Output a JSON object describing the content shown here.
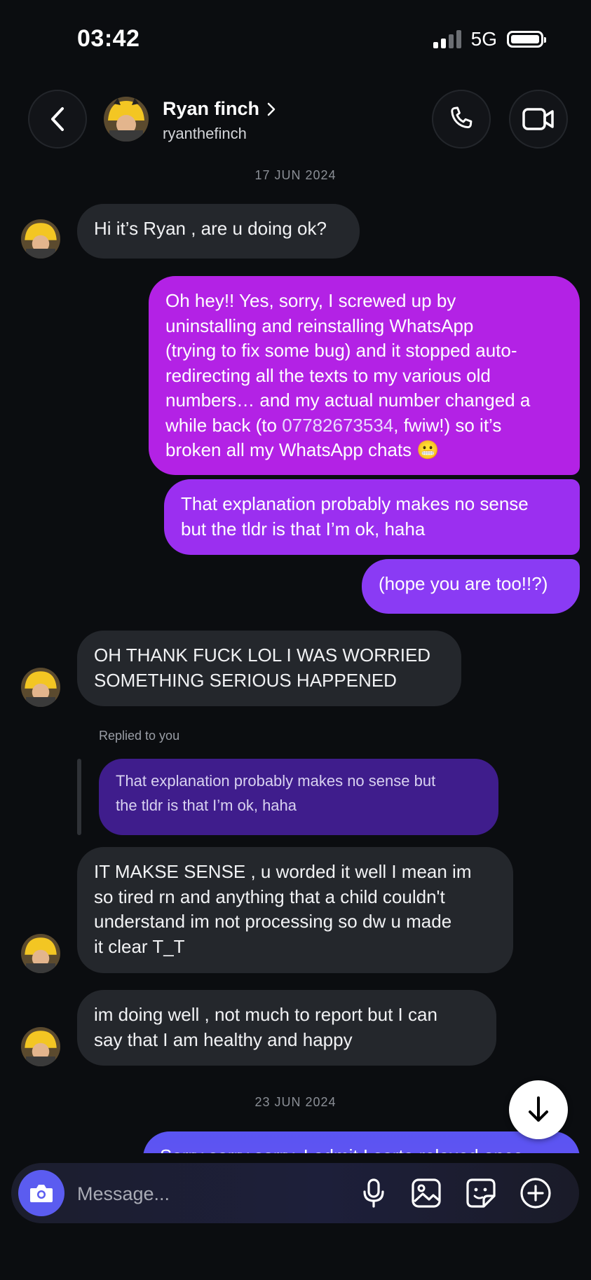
{
  "status_bar": {
    "time": "03:42",
    "network": "5G"
  },
  "header": {
    "name": "Ryan finch",
    "username": "ryanthefinch"
  },
  "dates": {
    "first": "17 JUN 2024",
    "second": "23 JUN 2024"
  },
  "messages": {
    "m1": "Hi it’s Ryan , are u doing ok?",
    "m2_lines": [
      "Oh hey!! Yes, sorry, I screwed up by",
      "uninstalling and reinstalling WhatsApp",
      "(trying to fix some bug) and it stopped auto-",
      "redirecting all the texts to my various old",
      "numbers… and my actual number changed a"
    ],
    "m2_l6_pre": "while back (to ",
    "m2_phone": "07782673534",
    "m2_l6_post": ", fwiw!) so it’s",
    "m2_l7": "broken all my WhatsApp chats 😬",
    "m3_lines": [
      "That explanation probably makes no sense",
      "but the tldr is that I’m ok, haha"
    ],
    "m4": "(hope you are too!!?)",
    "m5_lines": [
      "OH THANK FUCK LOL I WAS WORRIED",
      "SOMETHING SERIOUS HAPPENED"
    ],
    "replied_label": "Replied to you",
    "reply_quote_lines": [
      "That explanation probably makes no sense but",
      "the tldr is that I’m ok, haha"
    ],
    "m6_lines": [
      "IT MAKSE SENSE , u worded it well I mean im",
      "so tired rn and anything that a child couldn't",
      "understand im not processing so dw u made",
      "it clear T_T"
    ],
    "m7_lines": [
      "im doing well , not much to report but I can",
      "say that  I am healthy and happy"
    ],
    "m8": "Sorry sorry sorry. I admit I sorta relaxed once"
  },
  "composer": {
    "placeholder": "Message..."
  },
  "icons": {
    "back": "back-arrow-icon",
    "chevron": "chevron-right-icon",
    "call": "phone-icon",
    "video": "video-camera-icon",
    "camera": "camera-icon",
    "mic": "microphone-icon",
    "gallery": "image-icon",
    "sticker": "sticker-icon",
    "add": "plus-circle-icon",
    "scroll": "arrow-down-icon"
  },
  "colors": {
    "background": "#0b0d10",
    "incoming_bubble": "#24272c",
    "outgoing_gradient_top": "#b321e6",
    "outgoing_gradient_bottom": "#6a40f2",
    "accent": "#5b5cf0",
    "reply_bubble": "#3f1d8c"
  }
}
